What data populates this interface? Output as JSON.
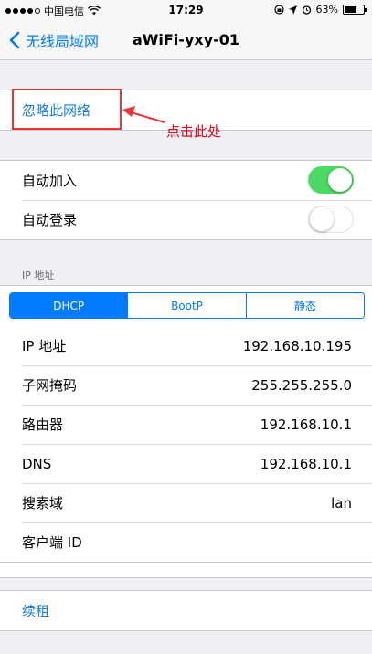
{
  "status_bar": {
    "carrier": "中国电信",
    "time": "17:29",
    "battery_percent": "63%",
    "battery_level": 0.63
  },
  "nav": {
    "back_label": "无线局域网",
    "title": "aWiFi-yxy-01"
  },
  "forget": {
    "label": "忽略此网络"
  },
  "annotation": {
    "text": "点击此处",
    "color": "#e60012"
  },
  "toggles": [
    {
      "label": "自动加入",
      "on": true
    },
    {
      "label": "自动登录",
      "on": false
    }
  ],
  "ip_section": {
    "header": "IP 地址",
    "segments": [
      "DHCP",
      "BootP",
      "静态"
    ],
    "active_segment": "DHCP",
    "rows": [
      {
        "label": "IP 地址",
        "value": "192.168.10.195"
      },
      {
        "label": "子网掩码",
        "value": "255.255.255.0"
      },
      {
        "label": "路由器",
        "value": "192.168.10.1"
      },
      {
        "label": "DNS",
        "value": "192.168.10.1"
      },
      {
        "label": "搜索域",
        "value": "lan"
      },
      {
        "label": "客户端 ID",
        "value": ""
      }
    ]
  },
  "renew": {
    "label": "续租"
  },
  "colors": {
    "accent": "#007aff",
    "toggle_on": "#4cd964",
    "background": "#efeff4",
    "highlight": "#ee3333"
  }
}
